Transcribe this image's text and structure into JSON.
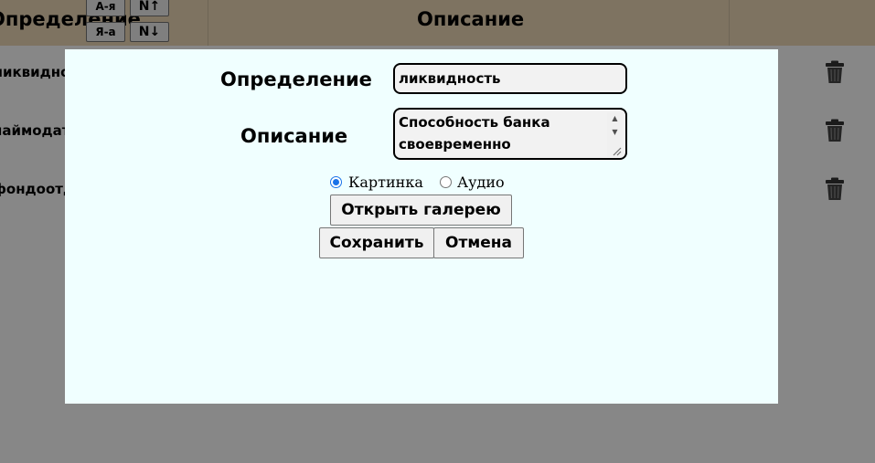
{
  "table": {
    "header": {
      "definition_label": "Определение",
      "description_label": "Описание",
      "sort_buttons": {
        "az": "А-я",
        "num_up": "N↑",
        "za": "Я-а",
        "num_down": "N↓"
      }
    },
    "rows": [
      {
        "term": "ликвидность"
      },
      {
        "term": "наймодатель"
      },
      {
        "term": "фондоотдача"
      }
    ]
  },
  "modal": {
    "definition_label": "Определение",
    "definition_value": "ликвидность",
    "description_label": "Описание",
    "description_value": "Способность банка своевременно",
    "radio": {
      "picture_label": "Картинка",
      "audio_label": "Аудио",
      "selected": "picture"
    },
    "open_gallery_label": "Открыть галерею",
    "save_label": "Сохранить",
    "cancel_label": "Отмена"
  },
  "colors": {
    "header_bg": "#efd9b8",
    "modal_bg": "#f0ffff",
    "radio_accent": "#1a73e8"
  },
  "icons": [
    "trash-icon",
    "scroll-up-icon",
    "scroll-down-icon",
    "resize-grip-icon"
  ]
}
